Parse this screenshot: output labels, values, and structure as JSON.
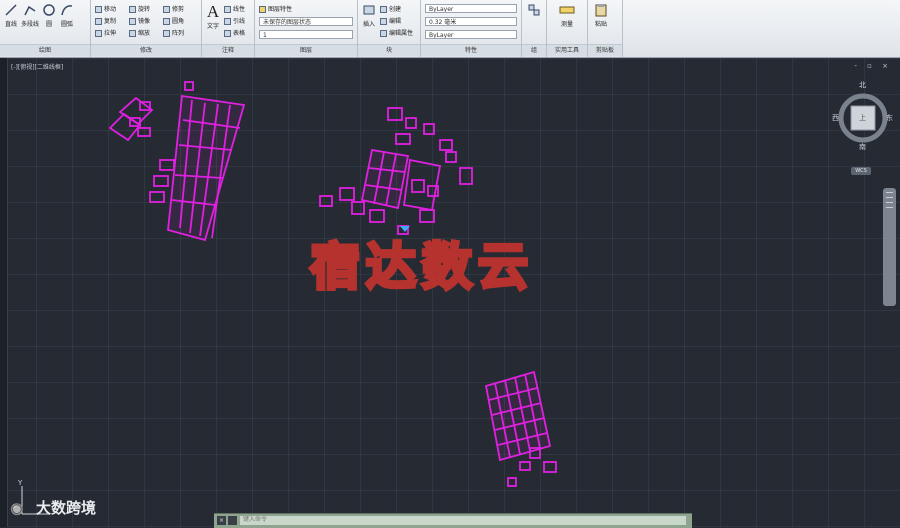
{
  "ribbon": {
    "panels": [
      {
        "title": "绘图"
      },
      {
        "title": "修改"
      },
      {
        "title": "注释"
      },
      {
        "title": "图层"
      },
      {
        "title": "块"
      },
      {
        "title": "特性"
      },
      {
        "title": "组"
      },
      {
        "title": "实用工具"
      },
      {
        "title": "剪贴板"
      }
    ],
    "draw": {
      "line": "直线",
      "polyline": "多段线",
      "circle": "圆",
      "arc": "圆弧"
    },
    "modify": {
      "move": "移动",
      "rotate": "旋转",
      "trim": "修剪",
      "copy": "复制",
      "mirror": "镜像",
      "fillet": "圆角",
      "stretch": "拉伸",
      "scale": "缩放",
      "array": "阵列"
    },
    "annotation": {
      "text": "文字",
      "linear": "线性",
      "leader": "引线",
      "table": "表格"
    },
    "layer": {
      "properties": "图层特性",
      "current": "未保存的图层状态",
      "layer_value": "1"
    },
    "block": {
      "insert": "插入",
      "create": "创建",
      "edit": "编辑",
      "attributes": "编辑属性"
    },
    "properties": {
      "color": "ByLayer",
      "lineweight": "0.32 毫米",
      "linetype": "ByLayer"
    },
    "group": {
      "group": "组"
    },
    "utilities": {
      "measure": "测量"
    },
    "clipboard": {
      "paste": "粘贴"
    }
  },
  "viewport": {
    "label": "[-][俯视][二维线框]",
    "window_controls": "- ▫ ×"
  },
  "viewcube": {
    "north": "北",
    "south": "南",
    "east": "东",
    "west": "西",
    "top": "上",
    "badge": "WCS"
  },
  "ucs": {
    "y": "Y",
    "x": "X"
  },
  "watermark": {
    "text": "宿达数云"
  },
  "platform_watermark": {
    "logo": "🔘",
    "text": "大数跨境"
  },
  "command": {
    "placeholder": "键入命令"
  },
  "colors": {
    "building": "#e020e0",
    "watermark": "#b5322e",
    "canvas": "#252a33",
    "command_bar": "#8ea48f"
  }
}
